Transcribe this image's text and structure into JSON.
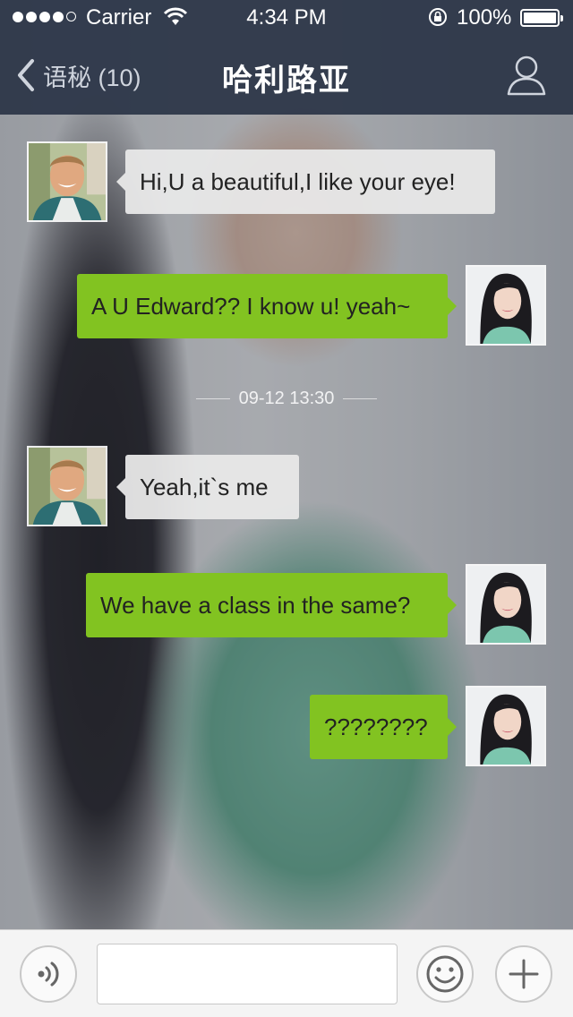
{
  "status_bar": {
    "carrier": "Carrier",
    "time": "4:34 PM",
    "battery": "100%",
    "signal_bars_filled": 4,
    "signal_bars_total": 5
  },
  "nav": {
    "back_label": "语秘 (10)",
    "title": "哈利路亚"
  },
  "chat": {
    "messages": [
      {
        "sender": "Edward",
        "direction": "incoming",
        "text": "Hi,U a beautiful,I like your eye!"
      },
      {
        "sender": "me",
        "direction": "outgoing",
        "text": "A U Edward?? I know u! yeah~"
      },
      {
        "timestamp": "09-12 13:30"
      },
      {
        "sender": "Edward",
        "direction": "incoming",
        "text": "Yeah,it`s me"
      },
      {
        "sender": "me",
        "direction": "outgoing",
        "text": "We have a class in the same?"
      },
      {
        "sender": "me",
        "direction": "outgoing",
        "text": "????????"
      }
    ]
  },
  "input_bar": {
    "text_value": "",
    "icons": [
      "voice-icon",
      "emoji-icon",
      "plus-icon"
    ]
  },
  "colors": {
    "nav_bg": "#2f384a",
    "outgoing_bubble": "#82c321",
    "incoming_bubble": "#e8e8e8",
    "input_bar_bg": "#f4f4f4"
  }
}
